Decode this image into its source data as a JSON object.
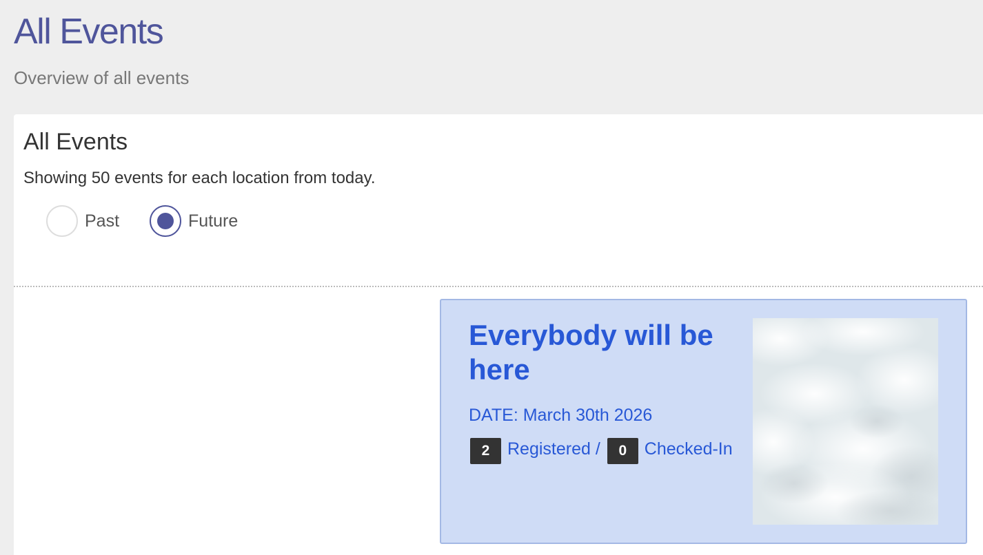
{
  "header": {
    "title": "All Events",
    "subtitle": "Overview of all events"
  },
  "panel": {
    "heading": "All Events",
    "description": "Showing 50 events for each location from today.",
    "filter": {
      "options": [
        {
          "label": "Past",
          "checked": false
        },
        {
          "label": "Future",
          "checked": true
        }
      ]
    }
  },
  "event": {
    "title": "Everybody will be here",
    "date": "DATE: March 30th 2026",
    "registered_count": "2",
    "registered_label": "Registered /",
    "checked_in_count": "0",
    "checked_in_label": "Checked-In",
    "image_icon": "cloudy-sky-image"
  },
  "colors": {
    "accent": "#4f559b",
    "card_background": "#cfdcf6",
    "card_border": "#a3b8e4",
    "link": "#2858d6",
    "badge": "#333333",
    "page_background": "#eeeeee"
  }
}
